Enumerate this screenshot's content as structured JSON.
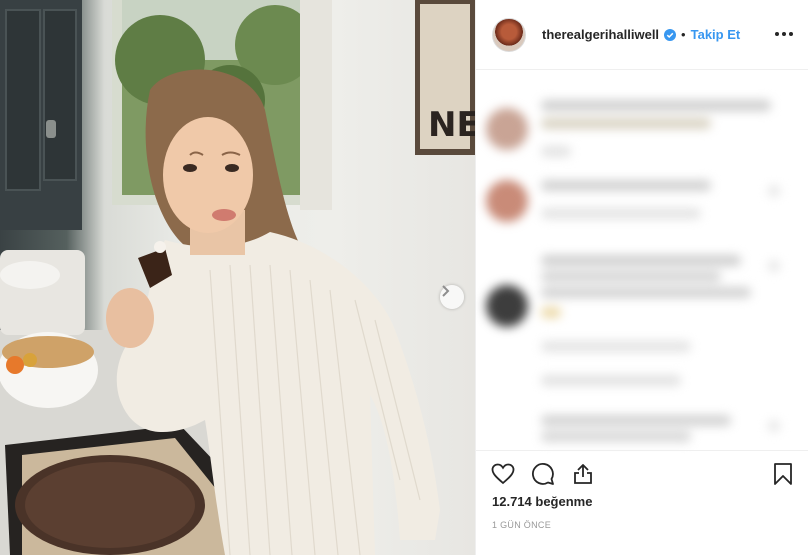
{
  "post": {
    "username": "therealgerihalliwell",
    "separator": "•",
    "follow_label": "Takip Et",
    "likes_text": "12.714 beğenme",
    "timestamp": "1 GÜN ÖNCE",
    "sign_text": "IS ALL NE"
  },
  "icons": {
    "verified": "verified-badge-icon",
    "more": "more-options-icon",
    "like": "heart-icon",
    "comment": "comment-icon",
    "share": "share-icon",
    "save": "bookmark-icon",
    "next": "chevron-right-icon"
  },
  "colors": {
    "link_blue": "#3897f0",
    "text": "#262626",
    "muted": "#999999",
    "divider": "#efefef"
  }
}
